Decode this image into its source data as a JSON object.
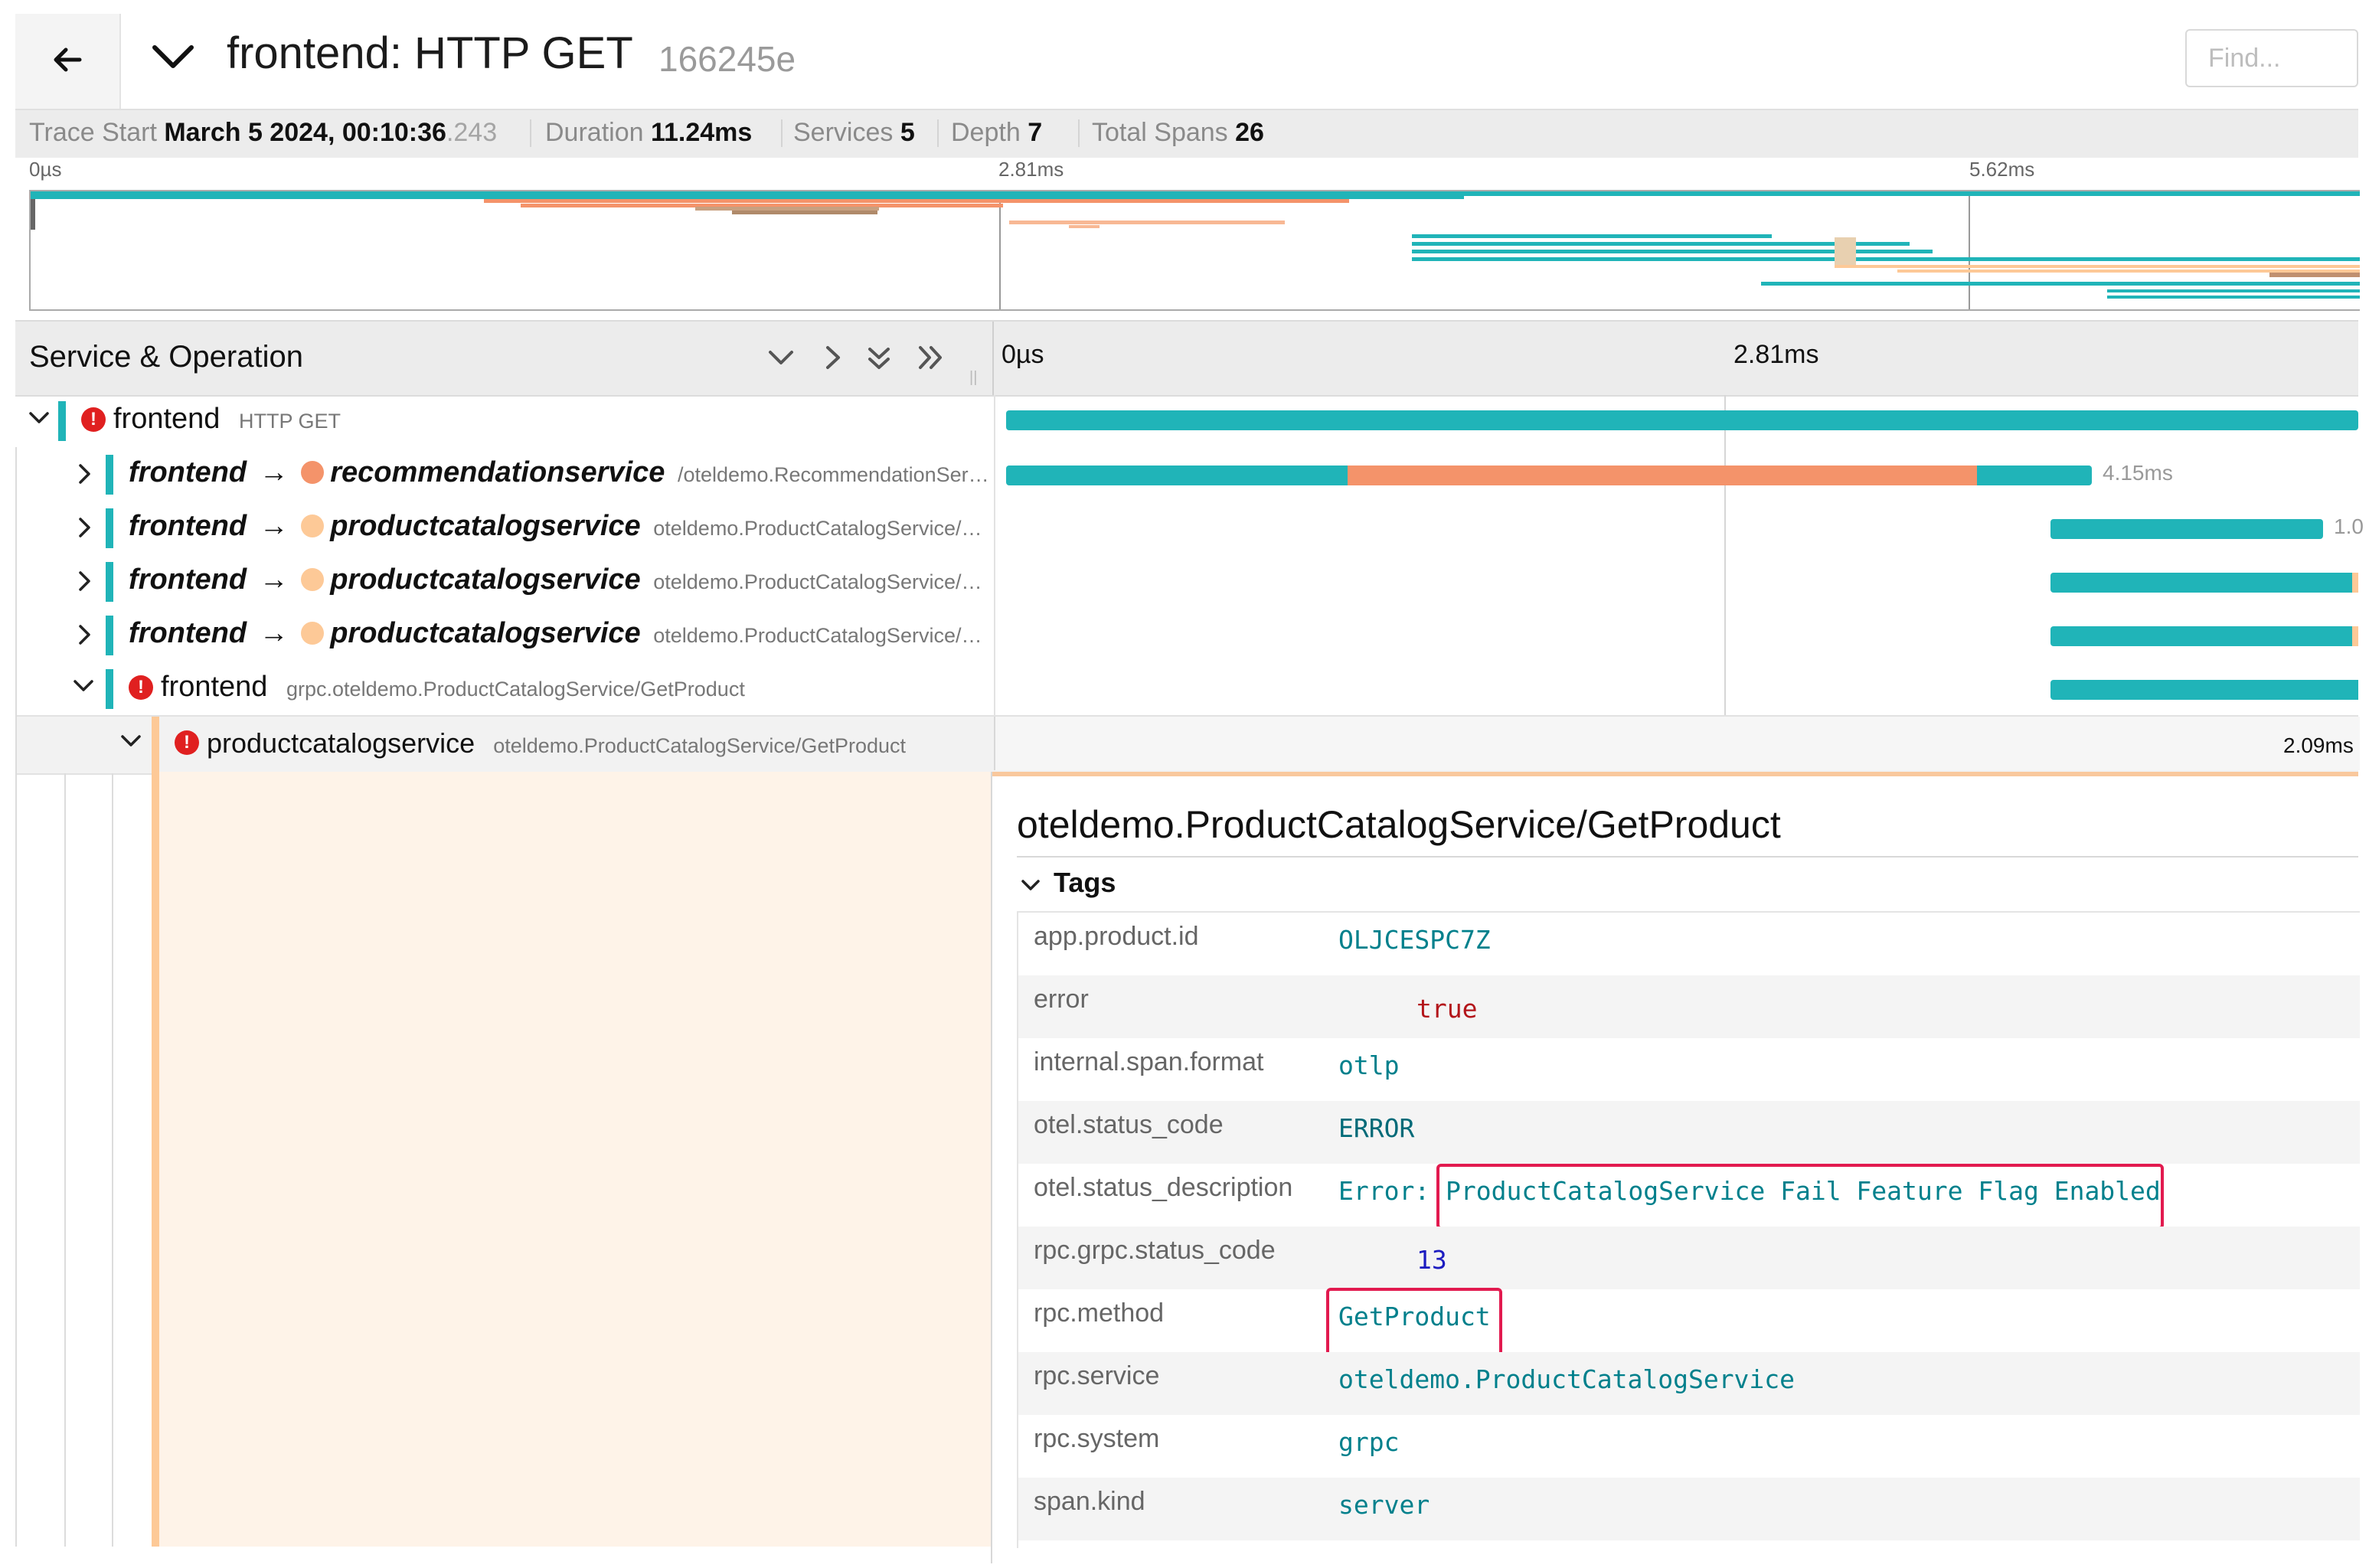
{
  "header": {
    "title": "frontend: HTTP GET",
    "trace_id": "166245e",
    "find_placeholder": "Find..."
  },
  "summary": {
    "trace_start_label": "Trace Start",
    "trace_start_value": "March 5 2024, 00:10:36",
    "trace_start_ms": ".243",
    "duration_label": "Duration",
    "duration_value": "11.24ms",
    "services_label": "Services",
    "services_value": "5",
    "depth_label": "Depth",
    "depth_value": "7",
    "total_spans_label": "Total Spans",
    "total_spans_value": "26"
  },
  "minimap": {
    "ticks": [
      "0µs",
      "2.81ms",
      "5.62ms"
    ]
  },
  "columns": {
    "service_operation": "Service & Operation",
    "timeline_ticks": [
      "0µs",
      "2.81ms"
    ]
  },
  "rows": [
    {
      "service": "frontend",
      "operation": "HTTP GET",
      "error": true,
      "expanded": true,
      "label": ""
    },
    {
      "service": "frontend",
      "arrow": "→",
      "target": "recommendationservice",
      "operation": "/oteldemo.RecommendationSer…",
      "label": "4.15ms",
      "target_color": "#f4936a"
    },
    {
      "service": "frontend",
      "arrow": "→",
      "target": "productcatalogservice",
      "operation": "oteldemo.ProductCatalogService/…",
      "label": "1.0",
      "target_color": "#fdc997"
    },
    {
      "service": "frontend",
      "arrow": "→",
      "target": "productcatalogservice",
      "operation": "oteldemo.ProductCatalogService/…",
      "label": "",
      "target_color": "#fdc997"
    },
    {
      "service": "frontend",
      "arrow": "→",
      "target": "productcatalogservice",
      "operation": "oteldemo.ProductCatalogService/…",
      "label": "",
      "target_color": "#fdc997"
    },
    {
      "service": "frontend",
      "operation": "grpc.oteldemo.ProductCatalogService/GetProduct",
      "error": true,
      "expanded": true,
      "label": ""
    },
    {
      "service": "productcatalogservice",
      "operation": "oteldemo.ProductCatalogService/GetProduct",
      "error": true,
      "expanded": true,
      "label": "2.09ms"
    }
  ],
  "detail": {
    "title": "oteldemo.ProductCatalogService/GetProduct",
    "tags_label": "Tags",
    "tags": [
      {
        "key": "app.product.id",
        "value": "OLJCESPC7Z"
      },
      {
        "key": "error",
        "value": "true"
      },
      {
        "key": "internal.span.format",
        "value": "otlp"
      },
      {
        "key": "otel.status_code",
        "value": "ERROR"
      },
      {
        "key": "otel.status_description",
        "value_prefix": "Error:",
        "value": "ProductCatalogService Fail Feature Flag Enabled"
      },
      {
        "key": "rpc.grpc.status_code",
        "value": "13"
      },
      {
        "key": "rpc.method",
        "value": "GetProduct"
      },
      {
        "key": "rpc.service",
        "value": "oteldemo.ProductCatalogService"
      },
      {
        "key": "rpc.system",
        "value": "grpc"
      },
      {
        "key": "span.kind",
        "value": "server"
      }
    ]
  },
  "colors": {
    "frontend": "#20b4b8",
    "recommendationservice": "#f4936a",
    "productcatalogservice": "#fdc997",
    "highlight": "#e21a4f",
    "error": "#e02020"
  }
}
